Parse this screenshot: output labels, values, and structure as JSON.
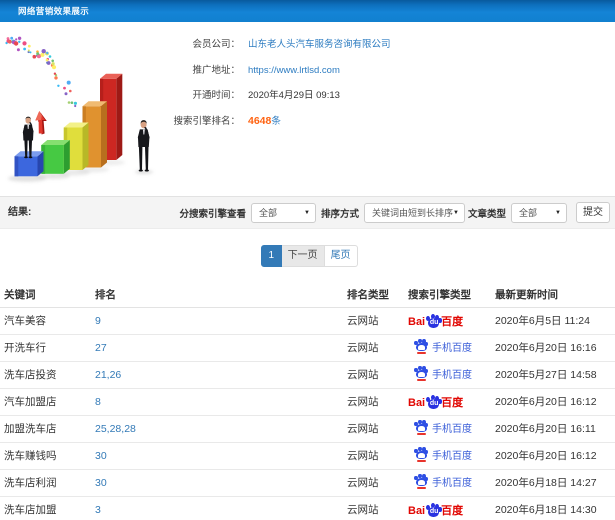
{
  "colors": {
    "titlebar_blue": "#1180cf",
    "link_blue": "#2d7cc1",
    "rank_blue": "#337ab7",
    "highlight_orange": "#ff6312",
    "pagination_active": "#337ab7",
    "baidu_red": "#e10602",
    "baidu_blue": "#2932e1",
    "mobile_baidu_blue": "#3c5fd8",
    "filterbar_gray": "#f4f4f4"
  },
  "titlebar": {
    "title": "网络营销效果展示"
  },
  "illustration": {
    "alt": "3d-growth-bar-chart-with-businessmen-and-confetti"
  },
  "info": {
    "rows": [
      {
        "label": "会员公司：",
        "value": "山东老人头汽车服务咨询有限公司"
      },
      {
        "label": "推广地址：",
        "value": "https://www.lrtlsd.com"
      },
      {
        "label": "开通时间：",
        "value": "2020年4月29日 09:13"
      },
      {
        "label": "搜索引擎排名：",
        "value": "4648",
        "suffix": "条"
      }
    ]
  },
  "filters": {
    "result_label": "结果:",
    "engine_label": "分搜索引擎查看",
    "engine_value": "全部",
    "sort_label": "排序方式",
    "sort_value": "关键词由短到长排序",
    "article_label": "文章类型",
    "article_value": "全部",
    "submit_label": "提交"
  },
  "pagination": {
    "current": "1",
    "next": "下一页",
    "last": "尾页"
  },
  "table": {
    "headers": [
      "关键词",
      "排名",
      "排名类型",
      "搜索引擎类型",
      "最新更新时间"
    ],
    "baidu_logo": {
      "bai": "Bai",
      "du": "du",
      "hanzi": "百度"
    },
    "mobile_logo": {
      "label": "手机百度"
    },
    "rows": [
      {
        "keyword": "汽车美容",
        "rank": "9",
        "rank_type": "云网站",
        "engine": "baidu",
        "updated": "2020年6月5日 11:24"
      },
      {
        "keyword": "开洗车行",
        "rank": "27",
        "rank_type": "云网站",
        "engine": "mobile-baidu",
        "updated": "2020年6月20日 16:16"
      },
      {
        "keyword": "洗车店投资",
        "rank": "21,26",
        "rank_type": "云网站",
        "engine": "mobile-baidu",
        "updated": "2020年5月27日 14:58"
      },
      {
        "keyword": "汽车加盟店",
        "rank": "8",
        "rank_type": "云网站",
        "engine": "baidu",
        "updated": "2020年6月20日 16:12"
      },
      {
        "keyword": "加盟洗车店",
        "rank": "25,28,28",
        "rank_type": "云网站",
        "engine": "mobile-baidu",
        "updated": "2020年6月20日 16:11"
      },
      {
        "keyword": "洗车赚钱吗",
        "rank": "30",
        "rank_type": "云网站",
        "engine": "mobile-baidu",
        "updated": "2020年6月20日 16:12"
      },
      {
        "keyword": "洗车店利润",
        "rank": "30",
        "rank_type": "云网站",
        "engine": "mobile-baidu",
        "updated": "2020年6月18日 14:27"
      },
      {
        "keyword": "洗车店加盟",
        "rank": "3",
        "rank_type": "云网站",
        "engine": "baidu",
        "updated": "2020年6月18日 14:30"
      }
    ]
  }
}
